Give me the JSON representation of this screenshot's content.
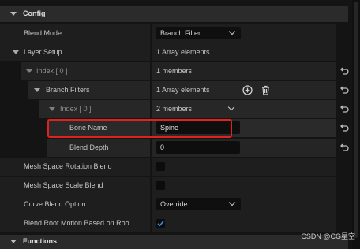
{
  "sections": {
    "config": "Config",
    "functions": "Functions"
  },
  "rows": {
    "blend_mode": {
      "label": "Blend Mode",
      "value": "Branch Filter"
    },
    "layer_setup": {
      "label": "Layer Setup",
      "value": "1 Array elements"
    },
    "index0": {
      "label": "Index [ 0 ]",
      "value": "1 members"
    },
    "branch_filters": {
      "label": "Branch Filters",
      "value": "1 Array elements"
    },
    "index0_inner": {
      "label": "Index [ 0 ]",
      "value": "2 members"
    },
    "bone_name": {
      "label": "Bone Name",
      "value": "Spine"
    },
    "blend_depth": {
      "label": "Blend Depth",
      "value": "0"
    },
    "mesh_space_rotation": {
      "label": "Mesh Space Rotation Blend",
      "checked": false
    },
    "mesh_space_scale": {
      "label": "Mesh Space Scale Blend",
      "checked": false
    },
    "curve_blend": {
      "label": "Curve Blend Option",
      "value": "Override"
    },
    "blend_root_motion": {
      "label": "Blend Root Motion Based on Roo...",
      "checked": true
    }
  },
  "icons": {
    "collapse": "triangle-down-icon",
    "reset": "reset-arrow-icon",
    "add": "plus-circle-icon",
    "delete": "trash-icon",
    "dropdown": "chevron-down-icon",
    "check": "checkmark-icon"
  },
  "colors": {
    "highlight": "#e0221d",
    "check": "#3d8fe0"
  },
  "watermark": "CSDN @CG星空"
}
